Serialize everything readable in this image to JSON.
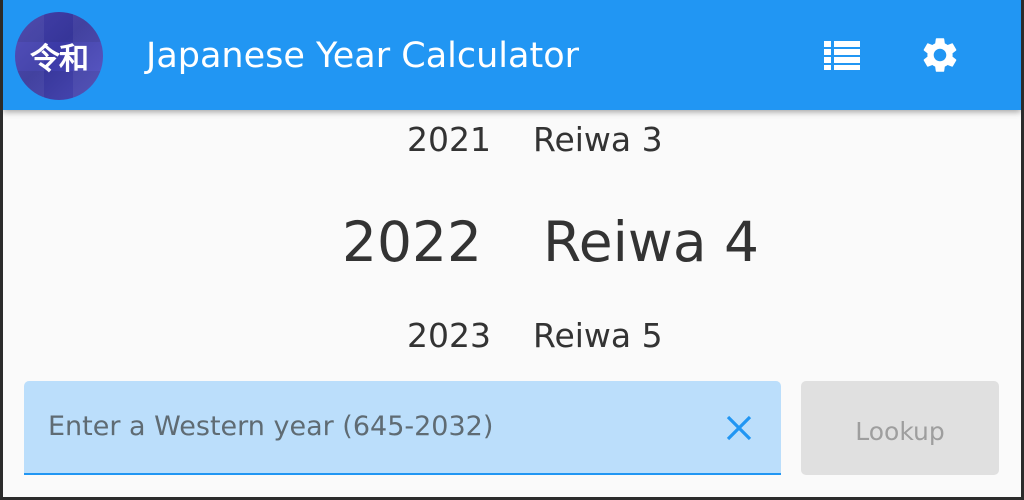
{
  "app": {
    "title": "Japanese Year Calculator",
    "logo_text": "令和",
    "colors": {
      "primary": "#2196f3",
      "input_fill": "#bbdefb",
      "button_disabled": "#e0e0e0"
    }
  },
  "toolbar": {
    "list_icon": "list-icon",
    "settings_icon": "gear-icon"
  },
  "years": {
    "previous": {
      "western": "2021",
      "era": "Reiwa 3"
    },
    "current": {
      "western": "2022",
      "era": "Reiwa 4"
    },
    "next": {
      "western": "2023",
      "era": "Reiwa 5"
    }
  },
  "search": {
    "value": "",
    "placeholder": "Enter a Western year (645-2032)",
    "clear_icon": "close-icon",
    "lookup_label": "Lookup"
  }
}
